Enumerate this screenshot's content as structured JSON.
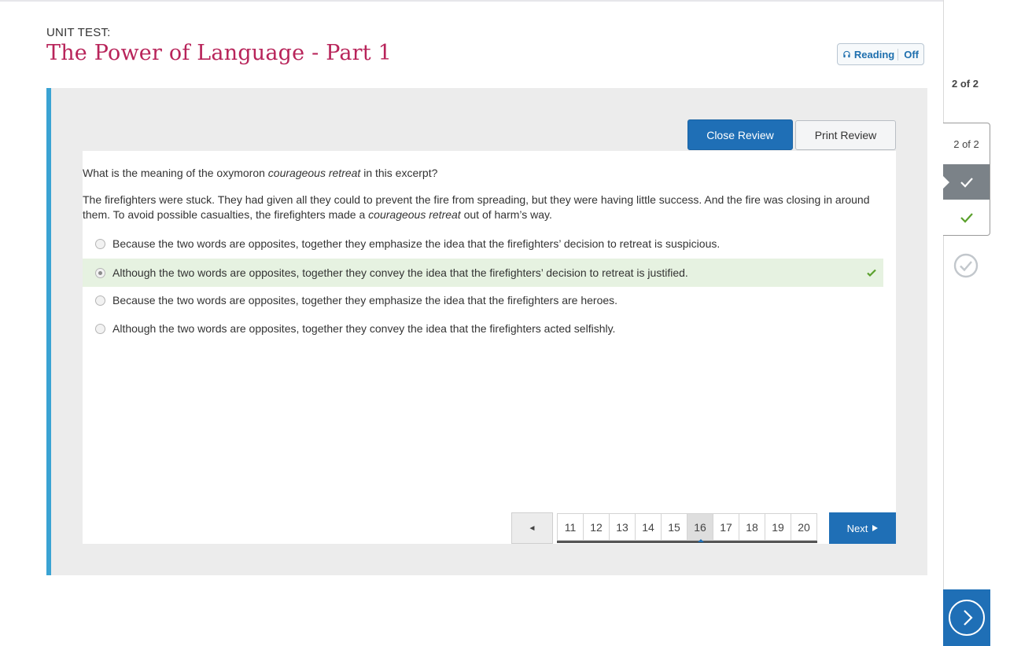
{
  "header": {
    "unit_label": "UNIT TEST:",
    "title": "The Power of Language - Part 1",
    "reading_label": "Reading",
    "reading_state": "Off"
  },
  "toolbar": {
    "close_review": "Close Review",
    "print_review": "Print Review"
  },
  "question": {
    "prompt_before": "What is the meaning of the oxymoron ",
    "prompt_italic": "courageous retreat",
    "prompt_after": " in this excerpt?",
    "excerpt_line1": "The firefighters were stuck. They had given all they could to prevent the fire from spreading, but they were having little success. And the fire was closing in around",
    "excerpt_line2_before": "them. To avoid possible casualties, the firefighters made a ",
    "excerpt_italic": "courageous retreat",
    "excerpt_line2_after": " out of harm’s way."
  },
  "options": [
    {
      "text": "Because the two words are opposites, together they emphasize the idea that the firefighters’ decision to retreat is suspicious.",
      "selected": false,
      "correct": false
    },
    {
      "text": "Although the two words are opposites, together they convey the idea that the firefighters’ decision to retreat is justified.",
      "selected": true,
      "correct": true
    },
    {
      "text": "Because the two words are opposites, together they emphasize the idea that the firefighters are heroes.",
      "selected": false,
      "correct": false
    },
    {
      "text": "Although the two words are opposites, together they convey the idea that the firefighters acted selfishly.",
      "selected": false,
      "correct": false
    }
  ],
  "pagination": {
    "prev": "◄",
    "pages": [
      "11",
      "12",
      "13",
      "14",
      "15",
      "16",
      "17",
      "18",
      "19",
      "20"
    ],
    "current": "16",
    "next": "Next"
  },
  "sidebar": {
    "count_top": "2 of 2",
    "count_box": "2 of 2"
  },
  "colors": {
    "title": "#b8245a",
    "accent": "#1f6fb6",
    "correct_bg": "#e6f2e1",
    "check_green": "#5aa02c"
  }
}
